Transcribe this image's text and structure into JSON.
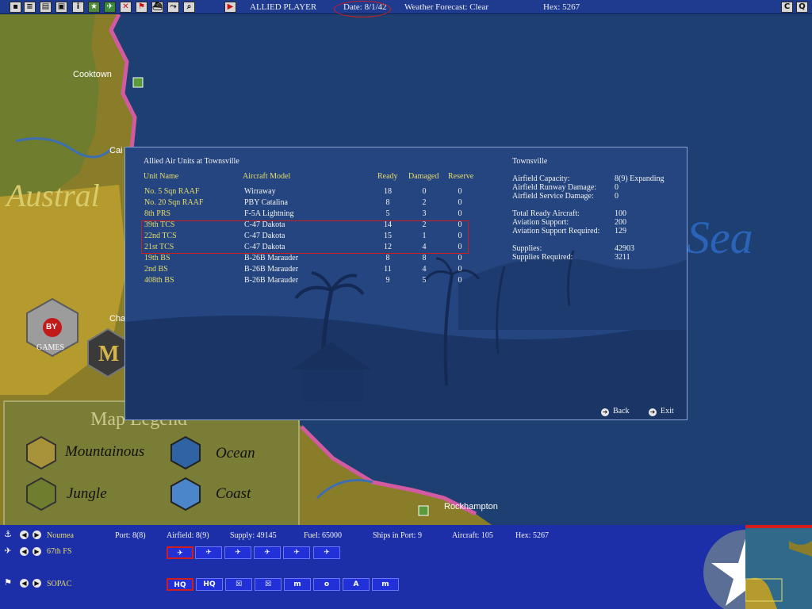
{
  "topbar": {
    "player": "ALLIED PLAYER",
    "date": "Date: 8/1/42",
    "weather": "Weather Forecast: Clear",
    "hex": "Hex: 5267",
    "buttons": [
      "C",
      "Q"
    ],
    "icons": [
      "save-icon",
      "document-icon",
      "report-icon",
      "print-icon",
      "info-icon",
      "star-icon",
      "plane-icon",
      "target-icon",
      "flag-icon",
      "ship-icon",
      "route-icon",
      "zoom-icon",
      "end-turn-icon"
    ]
  },
  "map": {
    "labels": {
      "cooktown": "Cooktown",
      "cairns": "Cai",
      "australia": "Austral",
      "sea": "Sea",
      "rockhampton": "Rockhampton",
      "charters": "Cha"
    },
    "colors": {
      "ocean": "#1d3f72",
      "land": "#c9a838",
      "coast": "#d25aa0"
    }
  },
  "badges": {
    "by": "BY",
    "games": "GAMES"
  },
  "dialog": {
    "title": "Allied Air Units at Townsville",
    "headers": {
      "unit": "Unit Name",
      "model": "Aircraft Model",
      "ready": "Ready",
      "damaged": "Damaged",
      "reserve": "Reserve"
    },
    "rows": [
      {
        "unit": "No. 5 Sqn RAAF",
        "model": "Wirraway",
        "ready": "18",
        "damaged": "0",
        "reserve": "0"
      },
      {
        "unit": "No. 20 Sqn RAAF",
        "model": "PBY Catalina",
        "ready": "8",
        "damaged": "2",
        "reserve": "0"
      },
      {
        "unit": "8th PRS",
        "model": "F-5A Lightning",
        "ready": "5",
        "damaged": "3",
        "reserve": "0"
      },
      {
        "unit": "39th TCS",
        "model": "C-47 Dakota",
        "ready": "14",
        "damaged": "2",
        "reserve": "0"
      },
      {
        "unit": "22nd TCS",
        "model": "C-47 Dakota",
        "ready": "15",
        "damaged": "1",
        "reserve": "0"
      },
      {
        "unit": "21st TCS",
        "model": "C-47 Dakota",
        "ready": "12",
        "damaged": "4",
        "reserve": "0"
      },
      {
        "unit": "19th BS",
        "model": "B-26B Marauder",
        "ready": "8",
        "damaged": "8",
        "reserve": "0"
      },
      {
        "unit": "2nd BS",
        "model": "B-26B Marauder",
        "ready": "11",
        "damaged": "4",
        "reserve": "0"
      },
      {
        "unit": "408th BS",
        "model": "B-26B Marauder",
        "ready": "9",
        "damaged": "5",
        "reserve": "0"
      }
    ],
    "base": {
      "name": "Townsville",
      "stats": [
        {
          "label": "Airfield Capacity:",
          "value": "8(9) Expanding"
        },
        {
          "label": "Airfield Runway Damage:",
          "value": "0"
        },
        {
          "label": "Airfield Service Damage:",
          "value": "0"
        },
        {
          "label": "Total Ready Aircraft:",
          "value": "100"
        },
        {
          "label": "Aviation Support:",
          "value": "200"
        },
        {
          "label": "Aviation Support Required:",
          "value": "129"
        },
        {
          "label": "Supplies:",
          "value": "42903"
        },
        {
          "label": "Supplies Required:",
          "value": "3211"
        }
      ]
    },
    "back": "Back",
    "exit": "Exit"
  },
  "legend": {
    "title": "Map Legend",
    "items": [
      "Mountainous",
      "Ocean",
      "Jungle",
      "Coast"
    ]
  },
  "bottombar": {
    "base": {
      "name": "Noumea",
      "port": "Port: 8(8)",
      "airfield": "Airfield: 8(9)",
      "supply": "Supply: 49145",
      "fuel": "Fuel: 65000",
      "ships": "Ships in Port: 9",
      "aircraft": "Aircraft: 105",
      "hex": "Hex: 5267"
    },
    "air_unit": "67th FS",
    "command": "SOPAC",
    "air_slots": [
      "fighter-icon",
      "bomber-icon",
      "bomber-icon",
      "heavy-bomber-icon",
      "fighter-icon",
      "seaplane-icon"
    ],
    "hq_slots": [
      "HQ",
      "HQ",
      "",
      "",
      "m",
      "o",
      "A",
      "m"
    ]
  }
}
